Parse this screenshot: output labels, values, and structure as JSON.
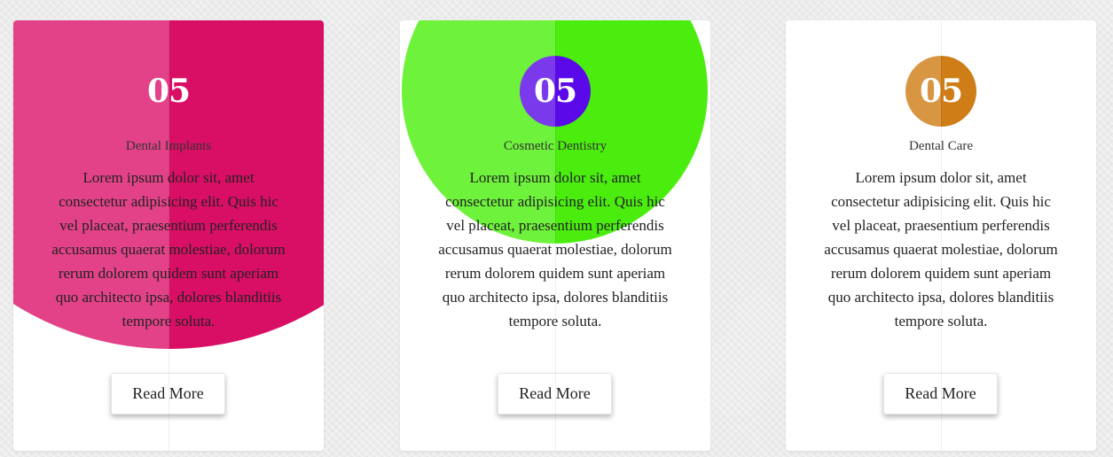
{
  "cards": [
    {
      "number": "05",
      "title": "Dental Implants",
      "description": "Lorem ipsum dolor sit, amet consectetur adipisicing elit. Quis hic vel placeat, praesentium perferendis accusamus quaerat molestiae, dolorum rerum dolorem quidem sunt aperiam quo architecto ipsa, dolores blanditiis tempore soluta.",
      "button_label": "Read More",
      "colors": {
        "accent_light": "#e34288",
        "accent_dark": "#d90f66"
      }
    },
    {
      "number": "05",
      "title": "Cosmetic Dentistry",
      "description": "Lorem ipsum dolor sit, amet consectetur adipisicing elit. Quis hic vel placeat, praesentium perferendis accusamus quaerat molestiae, dolorum rerum dolorem quidem sunt aperiam quo architecto ipsa, dolores blanditiis tempore soluta.",
      "button_label": "Read More",
      "colors": {
        "accent_light": "#6ef23b",
        "accent_dark": "#4bed0f",
        "badge_light": "#7a3aec",
        "badge_dark": "#5a0ae8"
      }
    },
    {
      "number": "05",
      "title": "Dental Care",
      "description": "Lorem ipsum dolor sit, amet consectetur adipisicing elit. Quis hic vel placeat, praesentium perferendis accusamus quaerat molestiae, dolorum rerum dolorem quidem sunt aperiam quo architecto ipsa, dolores blanditiis tempore soluta.",
      "button_label": "Read More",
      "colors": {
        "badge_light": "#d89643",
        "badge_dark": "#cf7d16"
      }
    }
  ]
}
